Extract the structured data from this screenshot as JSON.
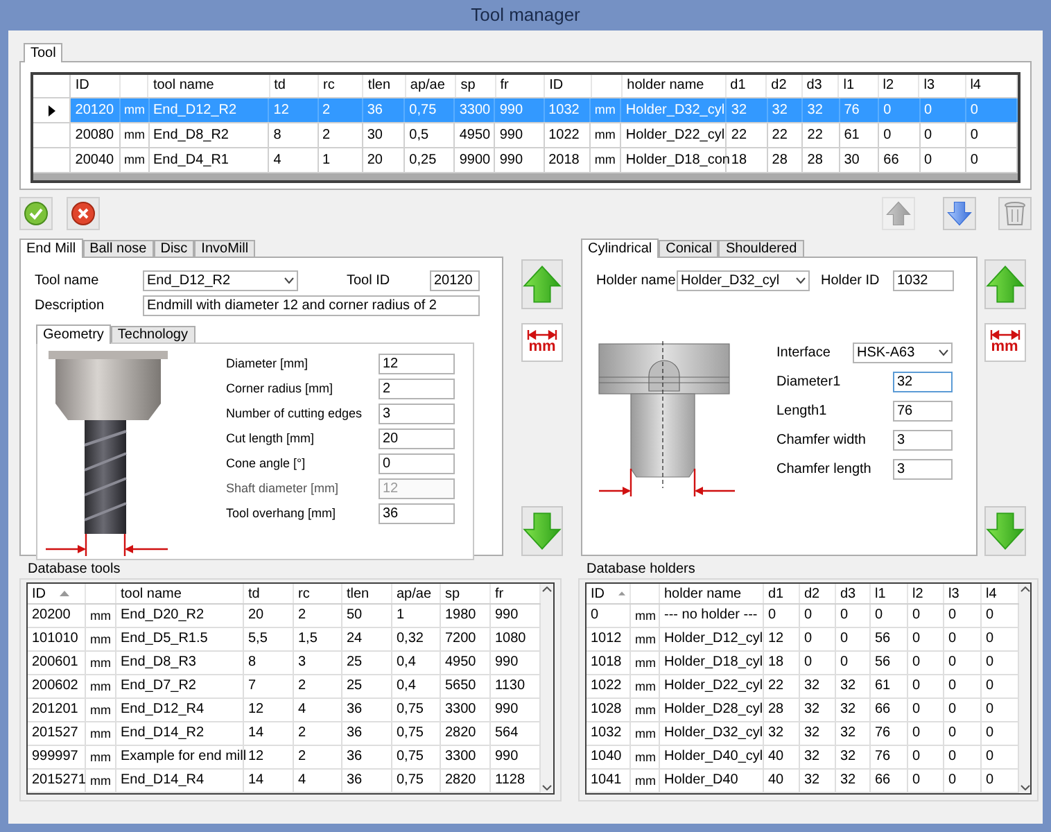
{
  "window": {
    "title": "Tool manager"
  },
  "top_tabs": [
    {
      "label": "Tool",
      "selected": true
    }
  ],
  "tool_grid": {
    "columns": [
      "ID",
      "",
      "tool name",
      "td",
      "rc",
      "tlen",
      "ap/ae",
      "sp",
      "fr",
      "ID",
      "",
      "holder name",
      "d1",
      "d2",
      "d3",
      "l1",
      "l2",
      "l3",
      "l4"
    ],
    "rows": [
      {
        "selected": true,
        "cells": [
          "20120",
          "mm",
          "End_D12_R2",
          "12",
          "2",
          "36",
          "0,75",
          "3300",
          "990",
          "1032",
          "mm",
          "Holder_D32_cyl",
          "32",
          "32",
          "32",
          "76",
          "0",
          "0",
          "0"
        ]
      },
      {
        "selected": false,
        "cells": [
          "20080",
          "mm",
          "End_D8_R2",
          "8",
          "2",
          "30",
          "0,5",
          "4950",
          "990",
          "1022",
          "mm",
          "Holder_D22_cyl",
          "22",
          "22",
          "22",
          "61",
          "0",
          "0",
          "0"
        ]
      },
      {
        "selected": false,
        "cells": [
          "20040",
          "mm",
          "End_D4_R1",
          "4",
          "1",
          "20",
          "0,25",
          "9900",
          "990",
          "2018",
          "mm",
          "Holder_D18_con",
          "18",
          "28",
          "28",
          "30",
          "66",
          "0",
          "0"
        ]
      }
    ]
  },
  "toolbar": {
    "move_up_disabled": true
  },
  "tool_tabs": [
    {
      "label": "End Mill",
      "selected": true
    },
    {
      "label": "Ball nose",
      "selected": false
    },
    {
      "label": "Disc",
      "selected": false
    },
    {
      "label": "InvoMill",
      "selected": false
    }
  ],
  "tool": {
    "name_label": "Tool name",
    "name": "End_D12_R2",
    "id_label": "Tool ID",
    "id": "20120",
    "description_label": "Description",
    "description": "Endmill with diameter 12 and corner radius of 2",
    "tabs": [
      {
        "label": "Geometry",
        "selected": true
      },
      {
        "label": "Technology",
        "selected": false
      }
    ],
    "fields": [
      {
        "label": "Diameter [mm]",
        "value": "12",
        "disabled": false
      },
      {
        "label": "Corner radius [mm]",
        "value": "2",
        "disabled": false
      },
      {
        "label": "Number of cutting edges",
        "value": "3",
        "disabled": false
      },
      {
        "label": "Cut length [mm]",
        "value": "20",
        "disabled": false
      },
      {
        "label": "Cone angle [°]",
        "value": "0",
        "disabled": false
      },
      {
        "label": "Shaft diameter [mm]",
        "value": "12",
        "disabled": true
      },
      {
        "label": "Tool overhang [mm]",
        "value": "36",
        "disabled": false
      }
    ]
  },
  "unit_labels": [
    "mm",
    "mm"
  ],
  "holder_tabs": [
    {
      "label": "Cylindrical",
      "selected": true
    },
    {
      "label": "Conical",
      "selected": false
    },
    {
      "label": "Shouldered",
      "selected": false
    }
  ],
  "holder": {
    "name_label": "Holder name",
    "name": "Holder_D32_cyl",
    "id_label": "Holder ID",
    "id": "1032",
    "interface_label": "Interface",
    "interface": "HSK-A63",
    "fields": [
      {
        "label": "Diameter1",
        "value": "32",
        "focused": true
      },
      {
        "label": "Length1",
        "value": "76",
        "focused": false
      },
      {
        "label": "Chamfer width",
        "value": "3",
        "focused": false
      },
      {
        "label": "Chamfer length",
        "value": "3",
        "focused": false
      }
    ]
  },
  "database_tools": {
    "title": "Database tools",
    "columns": [
      "ID",
      "",
      "tool name",
      "td",
      "rc",
      "tlen",
      "ap/ae",
      "sp",
      "fr"
    ],
    "rows": [
      [
        "20200",
        "mm",
        "End_D20_R2",
        "20",
        "2",
        "50",
        "1",
        "1980",
        "990"
      ],
      [
        "101010",
        "mm",
        "End_D5_R1.5",
        "5,5",
        "1,5",
        "24",
        "0,32",
        "7200",
        "1080"
      ],
      [
        "200601",
        "mm",
        "End_D8_R3",
        "8",
        "3",
        "25",
        "0,4",
        "4950",
        "990"
      ],
      [
        "200602",
        "mm",
        "End_D7_R2",
        "7",
        "2",
        "25",
        "0,4",
        "5650",
        "1130"
      ],
      [
        "201201",
        "mm",
        "End_D12_R4",
        "12",
        "4",
        "36",
        "0,75",
        "3300",
        "990"
      ],
      [
        "201527",
        "mm",
        "End_D14_R2",
        "14",
        "2",
        "36",
        "0,75",
        "2820",
        "564"
      ],
      [
        "999997",
        "mm",
        "Example for end mill",
        "12",
        "2",
        "36",
        "0,75",
        "3300",
        "990"
      ],
      [
        "2015271",
        "mm",
        "End_D14_R4",
        "14",
        "4",
        "36",
        "0,75",
        "2820",
        "1128"
      ]
    ]
  },
  "database_holders": {
    "title": "Database holders",
    "columns": [
      "ID",
      "",
      "holder name",
      "d1",
      "d2",
      "d3",
      "l1",
      "l2",
      "l3",
      "l4"
    ],
    "rows": [
      [
        "0",
        "mm",
        "--- no holder ---",
        "0",
        "0",
        "0",
        "0",
        "0",
        "0",
        "0"
      ],
      [
        "1012",
        "mm",
        "Holder_D12_cyl",
        "12",
        "0",
        "0",
        "56",
        "0",
        "0",
        "0"
      ],
      [
        "1018",
        "mm",
        "Holder_D18_cyl",
        "18",
        "0",
        "0",
        "56",
        "0",
        "0",
        "0"
      ],
      [
        "1022",
        "mm",
        "Holder_D22_cyl",
        "22",
        "32",
        "32",
        "61",
        "0",
        "0",
        "0"
      ],
      [
        "1028",
        "mm",
        "Holder_D28_cyl",
        "28",
        "32",
        "32",
        "66",
        "0",
        "0",
        "0"
      ],
      [
        "1032",
        "mm",
        "Holder_D32_cyl",
        "32",
        "32",
        "32",
        "76",
        "0",
        "0",
        "0"
      ],
      [
        "1040",
        "mm",
        "Holder_D40_cyl",
        "40",
        "32",
        "32",
        "76",
        "0",
        "0",
        "0"
      ],
      [
        "1041",
        "mm",
        "Holder_D40",
        "40",
        "32",
        "32",
        "66",
        "0",
        "0",
        "0"
      ]
    ]
  }
}
